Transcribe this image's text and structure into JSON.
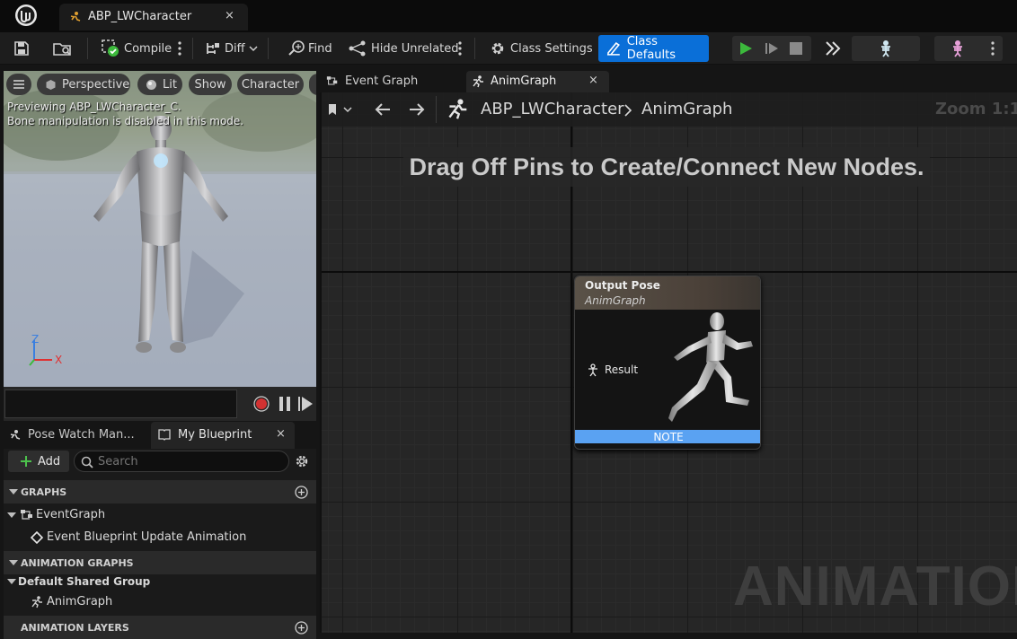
{
  "app": {
    "document_tab": "ABP_LWCharacter",
    "close_glyph": "×"
  },
  "toolbar": {
    "compile": "Compile",
    "diff": "Diff",
    "find": "Find",
    "hide_unrelated": "Hide Unrelated",
    "class_settings": "Class Settings",
    "class_defaults": "Class Defaults"
  },
  "viewport": {
    "perspective": "Perspective",
    "lit": "Lit",
    "show": "Show",
    "character": "Character",
    "info_line1": "Previewing ABP_LWCharacter_C.",
    "info_line2": "Bone manipulation is disabled in this mode.",
    "axis_z": "Z",
    "axis_x": "X"
  },
  "lower_tabs": {
    "pose_watch": "Pose Watch Man...",
    "my_blueprint": "My Blueprint"
  },
  "my_blueprint": {
    "add_label": "Add",
    "search_placeholder": "Search",
    "sections": {
      "graphs": "GRAPHS",
      "animation_graphs": "ANIMATION GRAPHS",
      "animation_layers": "ANIMATION LAYERS"
    },
    "event_graph": "EventGraph",
    "event_bp_update": "Event Blueprint Update Animation",
    "default_shared_group": "Default Shared Group",
    "anim_graph": "AnimGraph"
  },
  "graph_tabs": {
    "event_graph": "Event Graph",
    "anim_graph": "AnimGraph"
  },
  "breadcrumb": {
    "asset": "ABP_LWCharacter",
    "graph": "AnimGraph",
    "zoom": "Zoom 1:1"
  },
  "graph": {
    "hint": "Drag Off Pins to Create/Connect New Nodes.",
    "watermark": "ANIMATION",
    "node": {
      "title": "Output Pose",
      "subtitle": "AnimGraph",
      "pin": "Result",
      "footer": "NOTE"
    }
  },
  "colors": {
    "accent": "#0a6fd8",
    "note_bar": "#5aa2f2",
    "play_green": "#3cb93c",
    "record_red": "#d23232",
    "axis_x": "#e03030",
    "axis_z": "#3a7fe0"
  }
}
